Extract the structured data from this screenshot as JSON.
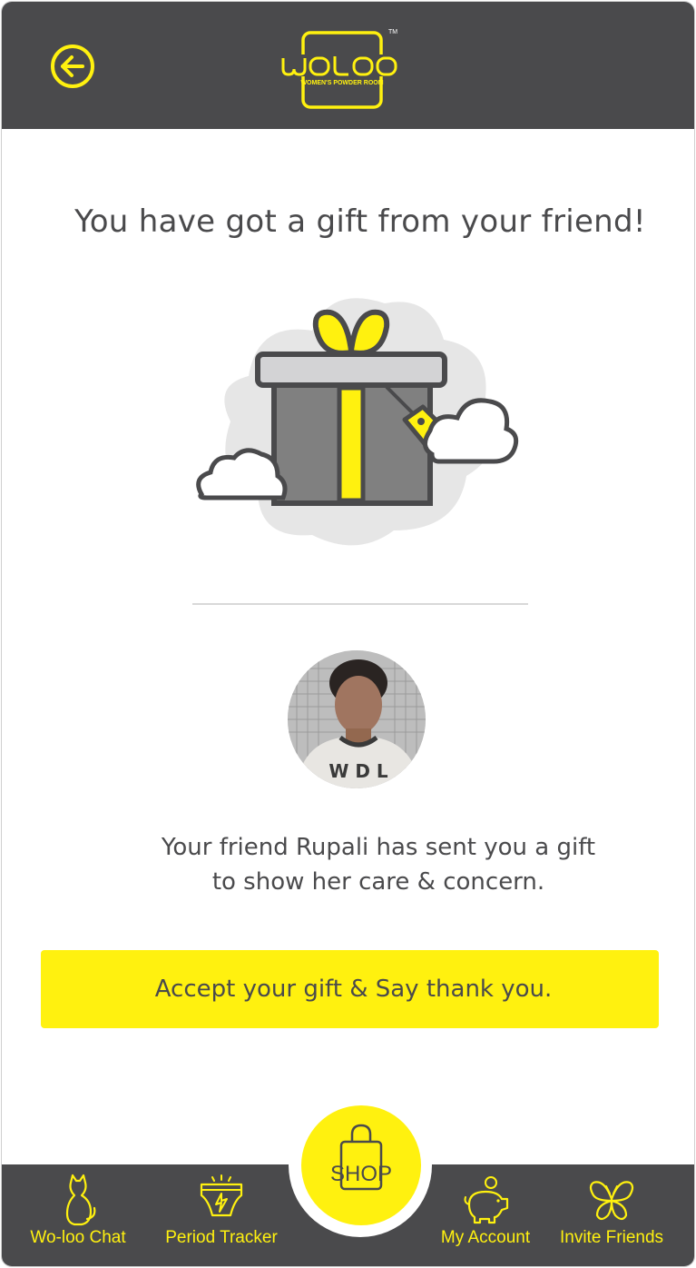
{
  "header": {
    "back_icon": "arrow-left-circle-icon",
    "logo": {
      "wordmark": "WOLOO",
      "tagline": "WOMEN'S POWDER ROOM",
      "trademark": "TM"
    }
  },
  "main": {
    "headline": "You have got a gift from your friend!",
    "illustration_icon": "gift-box-icon",
    "friend_avatar": "friend-avatar-photo",
    "message_line1": "Your friend Rupali has sent you a gift",
    "message_line2": "to show her care & concern.",
    "accept_button_label": "Accept your gift & Say thank you."
  },
  "bottom_nav": {
    "items": [
      {
        "label": "Wo-loo Chat",
        "icon": "cat-icon"
      },
      {
        "label": "Period Tracker",
        "icon": "period-underwear-icon"
      },
      {
        "label": "My Account",
        "icon": "piggy-bank-icon"
      },
      {
        "label": "Invite Friends",
        "icon": "butterfly-icon"
      }
    ],
    "shop": {
      "label": "SHOP",
      "icon": "shopping-bag-icon"
    }
  },
  "colors": {
    "brand_yellow": "#fff10f",
    "dark_gray": "#4a4a4c",
    "cloud_gray": "#e6e6e6",
    "box_gray": "#808080"
  }
}
